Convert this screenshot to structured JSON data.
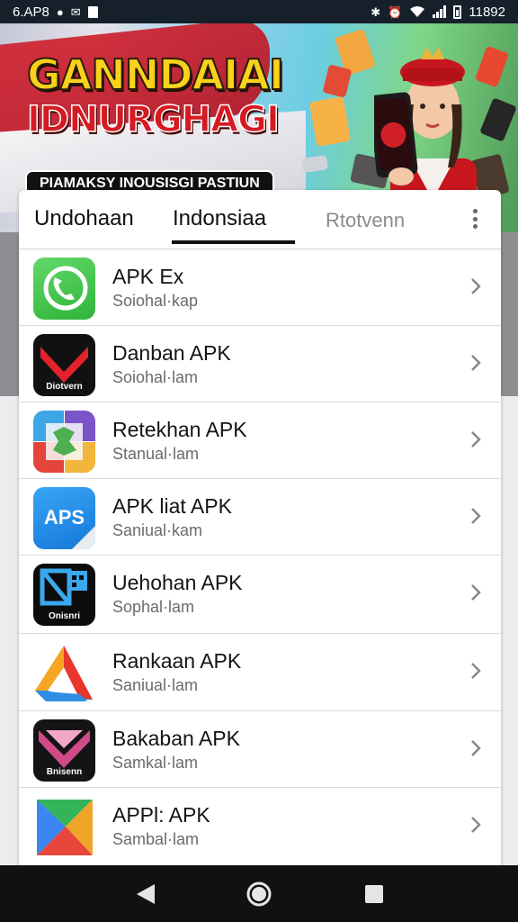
{
  "status_bar": {
    "left_text": "6.AP8",
    "time": "11892",
    "icons": [
      "disc-icon",
      "message-icon",
      "sim-icon",
      "bluetooth-icon",
      "alarm-icon",
      "wifi-icon",
      "signal-icon",
      "battery-icon"
    ]
  },
  "banner": {
    "title_line1": "GANNDAIAI",
    "title_line2": "IDNURGHAGI",
    "tagline": "PIAMAKSY INOUSISGI PASTIUN",
    "colors": {
      "flag_red": "#d21f2d",
      "title_yellow": "#f8d21b",
      "title_red": "#d51a22"
    }
  },
  "tabs": [
    {
      "label": "Undohaan",
      "active": false
    },
    {
      "label": "Indonsiaa",
      "active": true
    },
    {
      "label": "Rtotvenn",
      "active": false
    }
  ],
  "apps": [
    {
      "title": "APK Ex",
      "subtitle": "Soiohal·kap",
      "icon": "phone-call-icon",
      "icon_label": ""
    },
    {
      "title": "Danban APK",
      "subtitle": "Soiohal·lam",
      "icon": "red-chevron-icon",
      "icon_label": "Diotvern"
    },
    {
      "title": "Retekhan APK",
      "subtitle": "Stanual·lam",
      "icon": "colorful-tiles-icon",
      "icon_label": ""
    },
    {
      "title": "APK liat APK",
      "subtitle": "Saniual·kam",
      "icon": "apps-text-icon",
      "icon_label": "APS"
    },
    {
      "title": "Uehohan APK",
      "subtitle": "Sophal·lam",
      "icon": "blue-grid-icon",
      "icon_label": "Onisnri"
    },
    {
      "title": "Rankaan APK",
      "subtitle": "Saniual·lam",
      "icon": "triangle-arrow-icon",
      "icon_label": ""
    },
    {
      "title": "Bakaban APK",
      "subtitle": "Samkal·lam",
      "icon": "pink-heart-icon",
      "icon_label": "Bnisenn"
    },
    {
      "title": "APPl: APK",
      "subtitle": "Sambal·lam",
      "icon": "play-store-icon",
      "icon_label": ""
    }
  ],
  "nav": {
    "icons": [
      "back-icon",
      "home-icon",
      "recents-icon"
    ]
  }
}
